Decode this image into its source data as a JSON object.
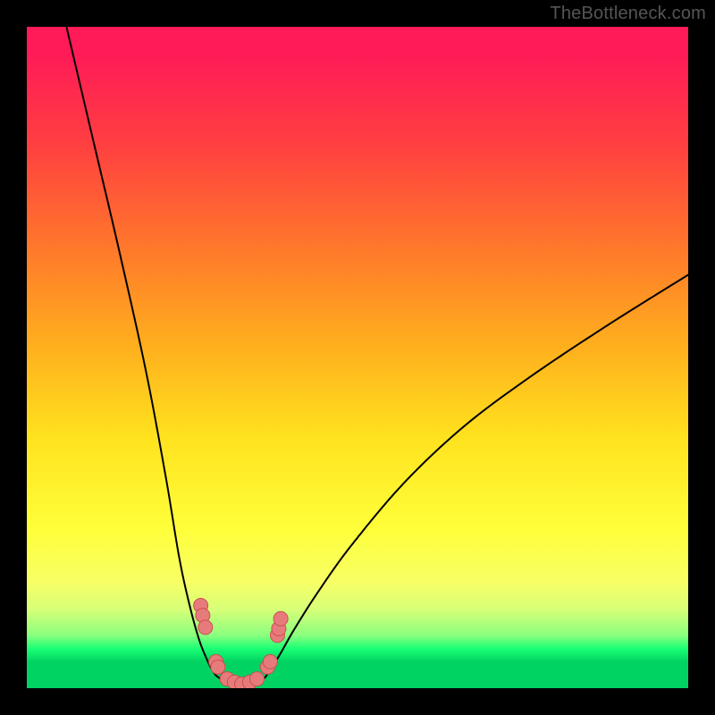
{
  "watermark": "TheBottleneck.com",
  "chart_data": {
    "type": "line",
    "title": "",
    "xlabel": "",
    "ylabel": "",
    "xlim": [
      0,
      100
    ],
    "ylim": [
      0,
      100
    ],
    "series": [
      {
        "name": "left-curve",
        "x": [
          6,
          10,
          14,
          18,
          21,
          23,
          24.5,
          26,
          27.3,
          28.3,
          29
        ],
        "values": [
          100,
          83,
          66,
          48,
          32,
          20,
          13,
          7.5,
          4.2,
          2.3,
          1.6
        ]
      },
      {
        "name": "right-curve",
        "x": [
          36,
          37,
          38.5,
          40.5,
          44,
          49,
          57,
          66,
          76,
          88,
          100
        ],
        "values": [
          1.6,
          3.0,
          5.5,
          9.0,
          14.5,
          21.5,
          31,
          39.5,
          47,
          55,
          62.5
        ]
      },
      {
        "name": "valley-floor",
        "x": [
          29,
          30.5,
          32.5,
          34.5,
          36
        ],
        "values": [
          1.6,
          0.9,
          0.6,
          0.9,
          1.6
        ]
      }
    ],
    "markers": [
      {
        "group": "left-cluster-upper",
        "points": [
          [
            26.3,
            12.5
          ],
          [
            26.6,
            11.0
          ],
          [
            27.0,
            9.2
          ]
        ]
      },
      {
        "group": "left-cluster-lower",
        "points": [
          [
            28.6,
            4.0
          ],
          [
            28.9,
            3.2
          ]
        ]
      },
      {
        "group": "valley-cluster",
        "points": [
          [
            30.3,
            1.4
          ],
          [
            31.4,
            0.9
          ],
          [
            32.5,
            0.6
          ],
          [
            33.7,
            0.9
          ],
          [
            34.8,
            1.4
          ]
        ]
      },
      {
        "group": "right-cluster-lower",
        "points": [
          [
            36.4,
            3.2
          ],
          [
            36.8,
            4.0
          ]
        ]
      },
      {
        "group": "right-cluster-upper",
        "points": [
          [
            37.9,
            8.0
          ],
          [
            38.1,
            9.0
          ],
          [
            38.4,
            10.5
          ]
        ]
      }
    ],
    "marker_style": {
      "fill": "#e77b7b",
      "stroke": "#c94f4f",
      "r": 8
    },
    "line_style": {
      "stroke": "#000000",
      "width": 2
    }
  }
}
